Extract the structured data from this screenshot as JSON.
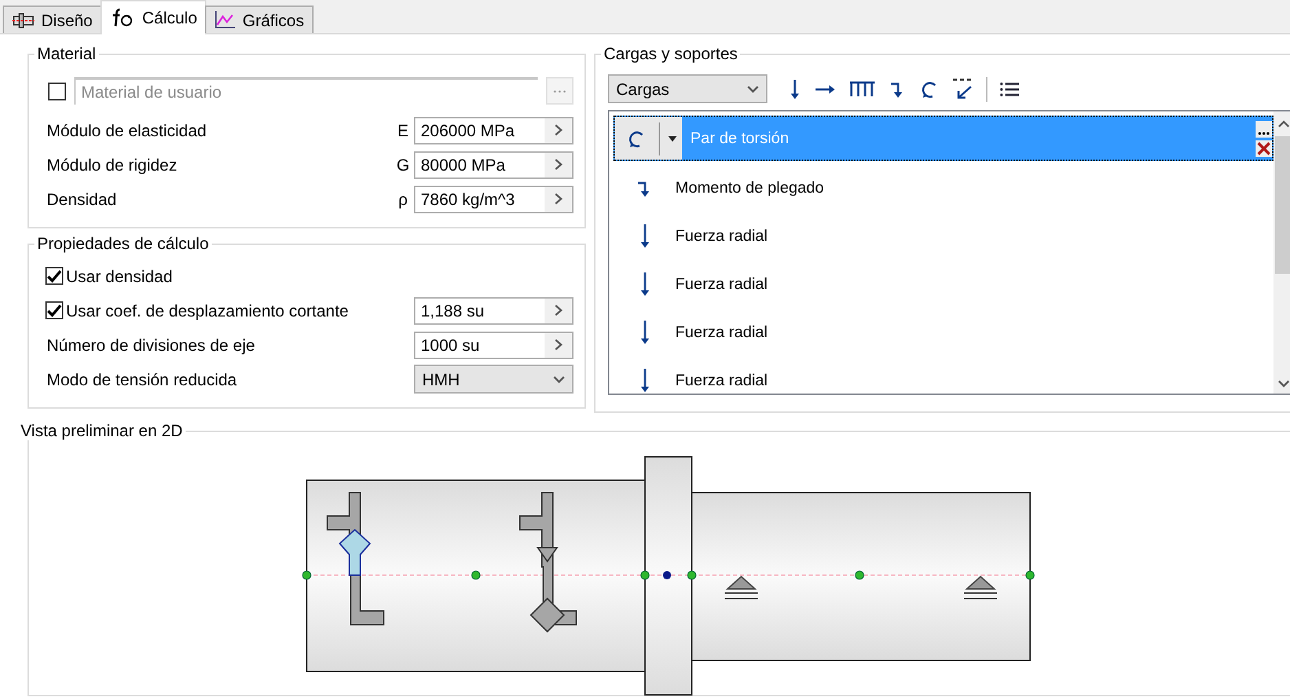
{
  "tabs": [
    {
      "label": "Diseño",
      "kind": "design",
      "selected": false
    },
    {
      "label": "Cálculo",
      "kind": "calc",
      "selected": true
    },
    {
      "label": "Gráficos",
      "kind": "charts",
      "selected": false
    }
  ],
  "material": {
    "title": "Material",
    "user_material": {
      "checked": false,
      "placeholder": "Material de usuario"
    },
    "properties": [
      {
        "label": "Módulo de elasticidad",
        "symbol": "E",
        "value": "206000 MPa"
      },
      {
        "label": "Módulo de rigidez",
        "symbol": "G",
        "value": "80000 MPa"
      },
      {
        "label": "Densidad",
        "symbol": "ρ",
        "value": "7860 kg/m^3"
      }
    ]
  },
  "calc_properties": {
    "title": "Propiedades de cálculo",
    "rows": [
      {
        "kind": "check",
        "label": "Usar densidad",
        "checked": true
      },
      {
        "kind": "check-field",
        "label": "Usar coef. de desplazamiento cortante",
        "checked": true,
        "value": "1,188 su"
      },
      {
        "kind": "field",
        "label": "Número de divisiones de eje",
        "value": "1000 su"
      },
      {
        "kind": "select",
        "label": "Modo de tensión reducida",
        "value": "HMH"
      }
    ]
  },
  "loads": {
    "title": "Cargas y soportes",
    "filter": "Cargas",
    "items": [
      {
        "kind": "torsion",
        "label": "Par de torsión",
        "selected": true
      },
      {
        "kind": "bending",
        "label": "Momento de plegado",
        "selected": false
      },
      {
        "kind": "radial",
        "label": "Fuerza radial",
        "selected": false
      },
      {
        "kind": "radial",
        "label": "Fuerza radial",
        "selected": false
      },
      {
        "kind": "radial",
        "label": "Fuerza radial",
        "selected": false
      },
      {
        "kind": "radial",
        "label": "Fuerza radial",
        "selected": false
      }
    ]
  },
  "preview": {
    "title": "Vista preliminar en 2D"
  }
}
